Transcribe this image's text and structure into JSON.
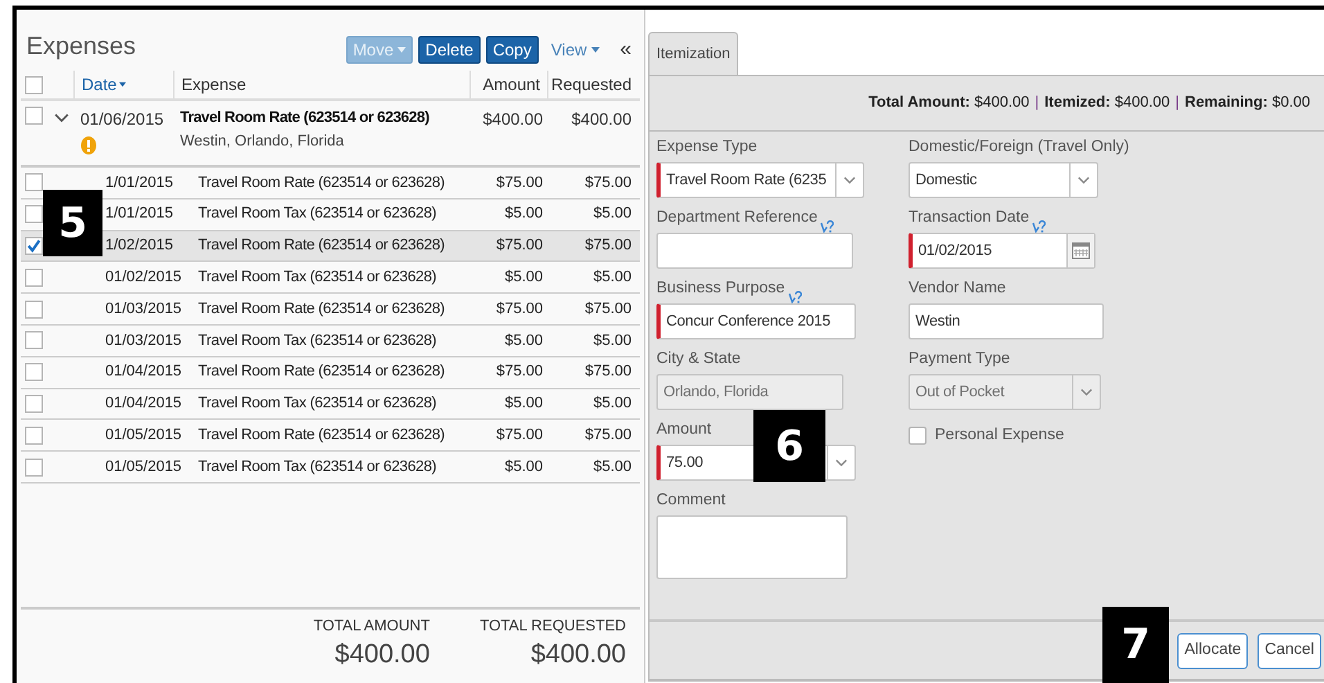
{
  "expenses": {
    "title": "Expenses",
    "toolbar": [
      {
        "label": "Move",
        "kind": "button",
        "disabled": true,
        "caret": true
      },
      {
        "label": "Delete",
        "kind": "button",
        "disabled": false,
        "caret": false
      },
      {
        "label": "Copy",
        "kind": "button",
        "disabled": false,
        "caret": false
      },
      {
        "label": "View",
        "kind": "link",
        "disabled": false,
        "caret": true
      }
    ],
    "collapse": "«",
    "select_all": {
      "checked": false
    },
    "columns": [
      {
        "label": "Date",
        "sorted": true
      },
      {
        "label": "Expense",
        "sorted": false
      },
      {
        "label": "Amount",
        "sorted": false
      },
      {
        "label": "Requested",
        "sorted": false
      }
    ],
    "parent": {
      "date": "01/06/2015",
      "expense": "Travel Room Rate (623514 or 623628)",
      "location": "Westin, Orlando, Florida",
      "amount": "$400.00",
      "requested": "$400.00",
      "checked": false,
      "expanded": true,
      "warning": true
    },
    "rows": [
      {
        "date": "1/01/2015",
        "expense": "Travel Room Rate (623514 or 623628)",
        "amount": "$75.00",
        "requested": "$75.00",
        "checked": false,
        "selected": false
      },
      {
        "date": "1/01/2015",
        "expense": "Travel Room Tax (623514 or 623628)",
        "amount": "$5.00",
        "requested": "$5.00",
        "checked": false,
        "selected": false
      },
      {
        "date": "1/02/2015",
        "expense": "Travel Room Rate (623514 or 623628)",
        "amount": "$75.00",
        "requested": "$75.00",
        "checked": true,
        "selected": true
      },
      {
        "date": "01/02/2015",
        "expense": "Travel Room Tax (623514 or 623628)",
        "amount": "$5.00",
        "requested": "$5.00",
        "checked": false,
        "selected": false
      },
      {
        "date": "01/03/2015",
        "expense": "Travel Room Rate (623514 or 623628)",
        "amount": "$75.00",
        "requested": "$75.00",
        "checked": false,
        "selected": false
      },
      {
        "date": "01/03/2015",
        "expense": "Travel Room Tax (623514 or 623628)",
        "amount": "$5.00",
        "requested": "$5.00",
        "checked": false,
        "selected": false
      },
      {
        "date": "01/04/2015",
        "expense": "Travel Room Rate (623514 or 623628)",
        "amount": "$75.00",
        "requested": "$75.00",
        "checked": false,
        "selected": false
      },
      {
        "date": "01/04/2015",
        "expense": "Travel Room Tax (623514 or 623628)",
        "amount": "$5.00",
        "requested": "$5.00",
        "checked": false,
        "selected": false
      },
      {
        "date": "01/05/2015",
        "expense": "Travel Room Rate (623514 or 623628)",
        "amount": "$75.00",
        "requested": "$75.00",
        "checked": false,
        "selected": false
      },
      {
        "date": "01/05/2015",
        "expense": "Travel Room Tax (623514 or 623628)",
        "amount": "$5.00",
        "requested": "$5.00",
        "checked": false,
        "selected": false
      }
    ],
    "totals": [
      {
        "label": "TOTAL AMOUNT",
        "value": "$400.00"
      },
      {
        "label": "TOTAL REQUESTED",
        "value": "$400.00"
      }
    ]
  },
  "itemization": {
    "tabs": [
      {
        "label": "Itemization",
        "selected": true
      }
    ],
    "summary": [
      {
        "label": "Total Amount:",
        "value": "$400.00"
      },
      {
        "label": "Itemized:",
        "value": "$400.00"
      },
      {
        "label": "Remaining:",
        "value": "$0.00"
      }
    ],
    "separator": "|",
    "left_fields": [
      {
        "kind": "select",
        "label": "Expense Type",
        "value": "Travel Room Rate (6235",
        "required": true,
        "disabled": false
      },
      {
        "kind": "text",
        "label": "Department Reference",
        "required": false,
        "help": true,
        "disabled": false
      },
      {
        "kind": "text",
        "label": "Business Purpose",
        "value": "Concur Conference 2015",
        "required": true,
        "help": true,
        "disabled": false
      },
      {
        "kind": "text",
        "label": "City & State",
        "value": "Orlando, Florida",
        "required": false,
        "disabled": true
      },
      {
        "kind": "select",
        "label": "Amount",
        "value": "75.00",
        "required": true,
        "disabled": false
      },
      {
        "kind": "textarea",
        "label": "Comment",
        "required": false,
        "disabled": false
      }
    ],
    "right_fields": [
      {
        "kind": "select",
        "label": "Domestic/Foreign (Travel Only)",
        "value": "Domestic",
        "required": false,
        "disabled": false
      },
      {
        "kind": "date",
        "label": "Transaction Date",
        "value": "01/02/2015",
        "required": true,
        "help": true,
        "disabled": false
      },
      {
        "kind": "text",
        "label": "Vendor Name",
        "value": "Westin",
        "required": false,
        "disabled": false
      },
      {
        "kind": "select",
        "label": "Payment Type",
        "value": "Out of Pocket",
        "required": false,
        "disabled": true
      },
      {
        "kind": "checkbox",
        "label": "Personal Expense",
        "checked": false
      }
    ],
    "buttons": [
      "Allocate",
      "Cancel"
    ]
  },
  "callouts": [
    "5",
    "6",
    "7"
  ]
}
